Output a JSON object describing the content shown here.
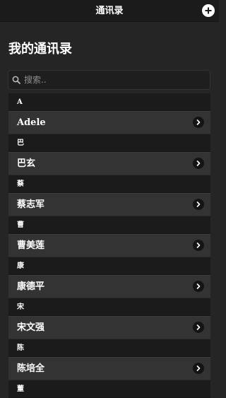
{
  "header": {
    "title": "通讯录",
    "add_icon": "plus-circle-icon"
  },
  "page": {
    "title": "我的通讯录"
  },
  "search": {
    "placeholder": "搜索..",
    "value": "",
    "icon": "search-icon"
  },
  "groups": [
    {
      "letter": "A",
      "contacts": [
        {
          "name": "Adele"
        }
      ]
    },
    {
      "letter": "巴",
      "contacts": [
        {
          "name": "巴玄"
        }
      ]
    },
    {
      "letter": "蔡",
      "contacts": [
        {
          "name": "蔡志军"
        }
      ]
    },
    {
      "letter": "曹",
      "contacts": [
        {
          "name": "曹美莲"
        }
      ]
    },
    {
      "letter": "康",
      "contacts": [
        {
          "name": "康德平"
        }
      ]
    },
    {
      "letter": "宋",
      "contacts": [
        {
          "name": "宋文强"
        }
      ]
    },
    {
      "letter": "陈",
      "contacts": [
        {
          "name": "陈培全"
        }
      ]
    },
    {
      "letter": "董",
      "contacts": []
    }
  ],
  "colors": {
    "background": "#252525",
    "header": "#1b1b1b",
    "row": "#333333",
    "divider": "#1b1b1b",
    "chevron_bg": "#141414",
    "text": "#ffffff"
  }
}
